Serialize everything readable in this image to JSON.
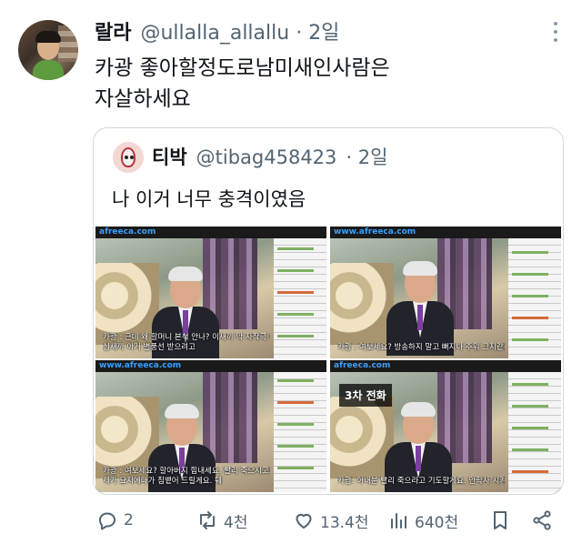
{
  "author": {
    "name": "랄라",
    "handle": "@ullalla_allallu",
    "time": "· 2일"
  },
  "tweet": {
    "line1": "카광 좋아할정도로남미새인사람은",
    "line2": "자살하세요"
  },
  "quoted": {
    "name": "티박",
    "handle": "@tibag458423",
    "time": "· 2일",
    "text": "나 이거 너무 충격이였음",
    "media": [
      {
        "logo": "afreeca.com",
        "caption_1": "카광 : 근데 왜 할머니 본척 안나? 이새끼 막 자작극 하는거 아냐?",
        "caption_2": "십새끼 이거 별풍선 받으려고"
      },
      {
        "logo": "www.afreeca.com",
        "caption_1": "카광 : 여보세요? 방송하지 말고 뻐지나 주워 그지같은 새끼야 충갈은 새끼야",
        "caption_2": ""
      },
      {
        "logo": "www.afreeca.com",
        "caption_1": "카광 : 여보세요? 할아버지 힘내세요. 빨리 죽으시고요.",
        "caption_2": "제가 묘지에다가 침뱉어 드릴게요. 퉤"
      },
      {
        "logo": "afreeca.com",
        "badge": "3차 전화",
        "caption_1": "카광: 아내분 빨리 죽으라고 기도할게요. 안락사 시켜 드릴까요?",
        "caption_2": ""
      }
    ]
  },
  "actions": {
    "replies": "2",
    "reposts": "4천",
    "likes": "13.4천",
    "views": "640천"
  },
  "icons": [
    "more-icon",
    "reply-icon",
    "repost-icon",
    "like-icon",
    "views-icon",
    "bookmark-icon",
    "share-icon"
  ]
}
